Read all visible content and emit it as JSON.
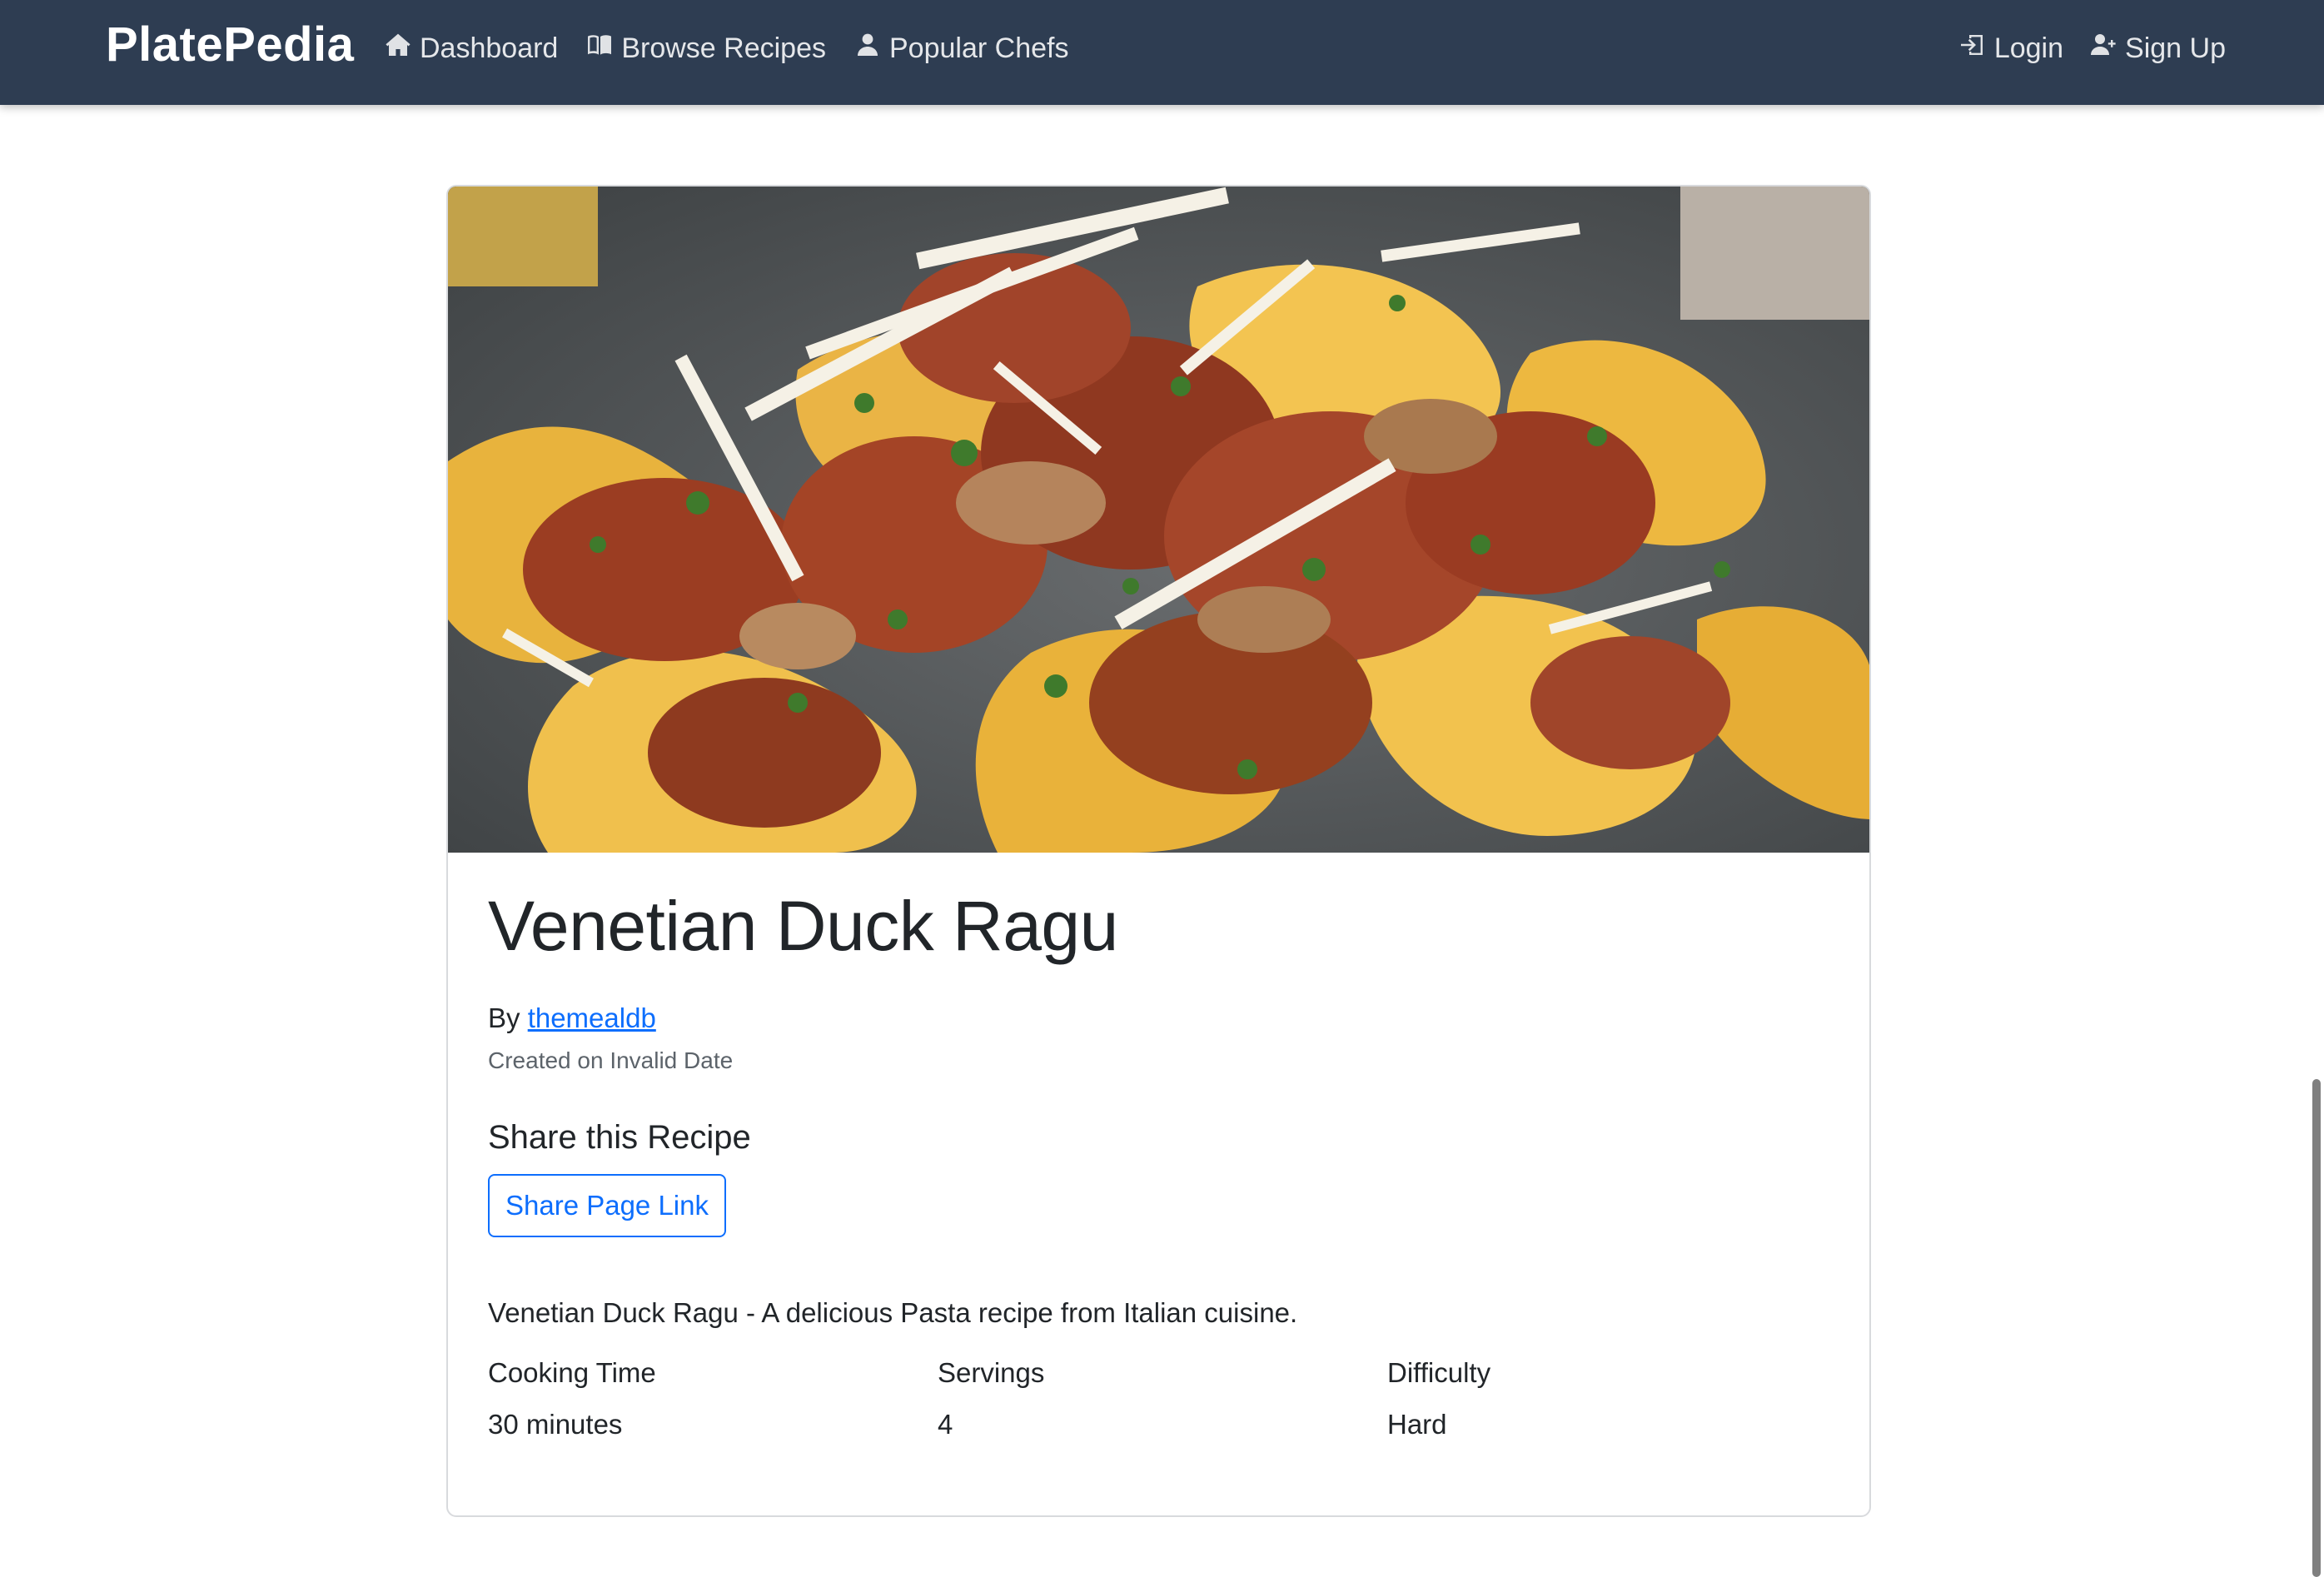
{
  "navbar": {
    "brand": "PlatePedia",
    "left_items": [
      {
        "label": "Dashboard",
        "icon": "home-icon"
      },
      {
        "label": "Browse Recipes",
        "icon": "book-icon"
      },
      {
        "label": "Popular Chefs",
        "icon": "person-icon"
      }
    ],
    "right_items": [
      {
        "label": "Login",
        "icon": "login-icon"
      },
      {
        "label": "Sign Up",
        "icon": "person-add-icon"
      }
    ]
  },
  "recipe": {
    "image_alt": "Venetian Duck Ragu photo",
    "title": "Venetian Duck Ragu",
    "by_prefix": "By",
    "author": "themealdb",
    "created": "Created on Invalid Date",
    "share_heading": "Share this Recipe",
    "share_button": "Share Page Link",
    "description": "Venetian Duck Ragu - A delicious Pasta recipe from Italian cuisine.",
    "stats": [
      {
        "label": "Cooking Time",
        "value": "30 minutes"
      },
      {
        "label": "Servings",
        "value": "4"
      },
      {
        "label": "Difficulty",
        "value": "Hard"
      }
    ]
  },
  "colors": {
    "navbar_bg": "#2e3d52",
    "link": "#0d6efd",
    "text": "#212529",
    "muted": "#5c636a"
  }
}
